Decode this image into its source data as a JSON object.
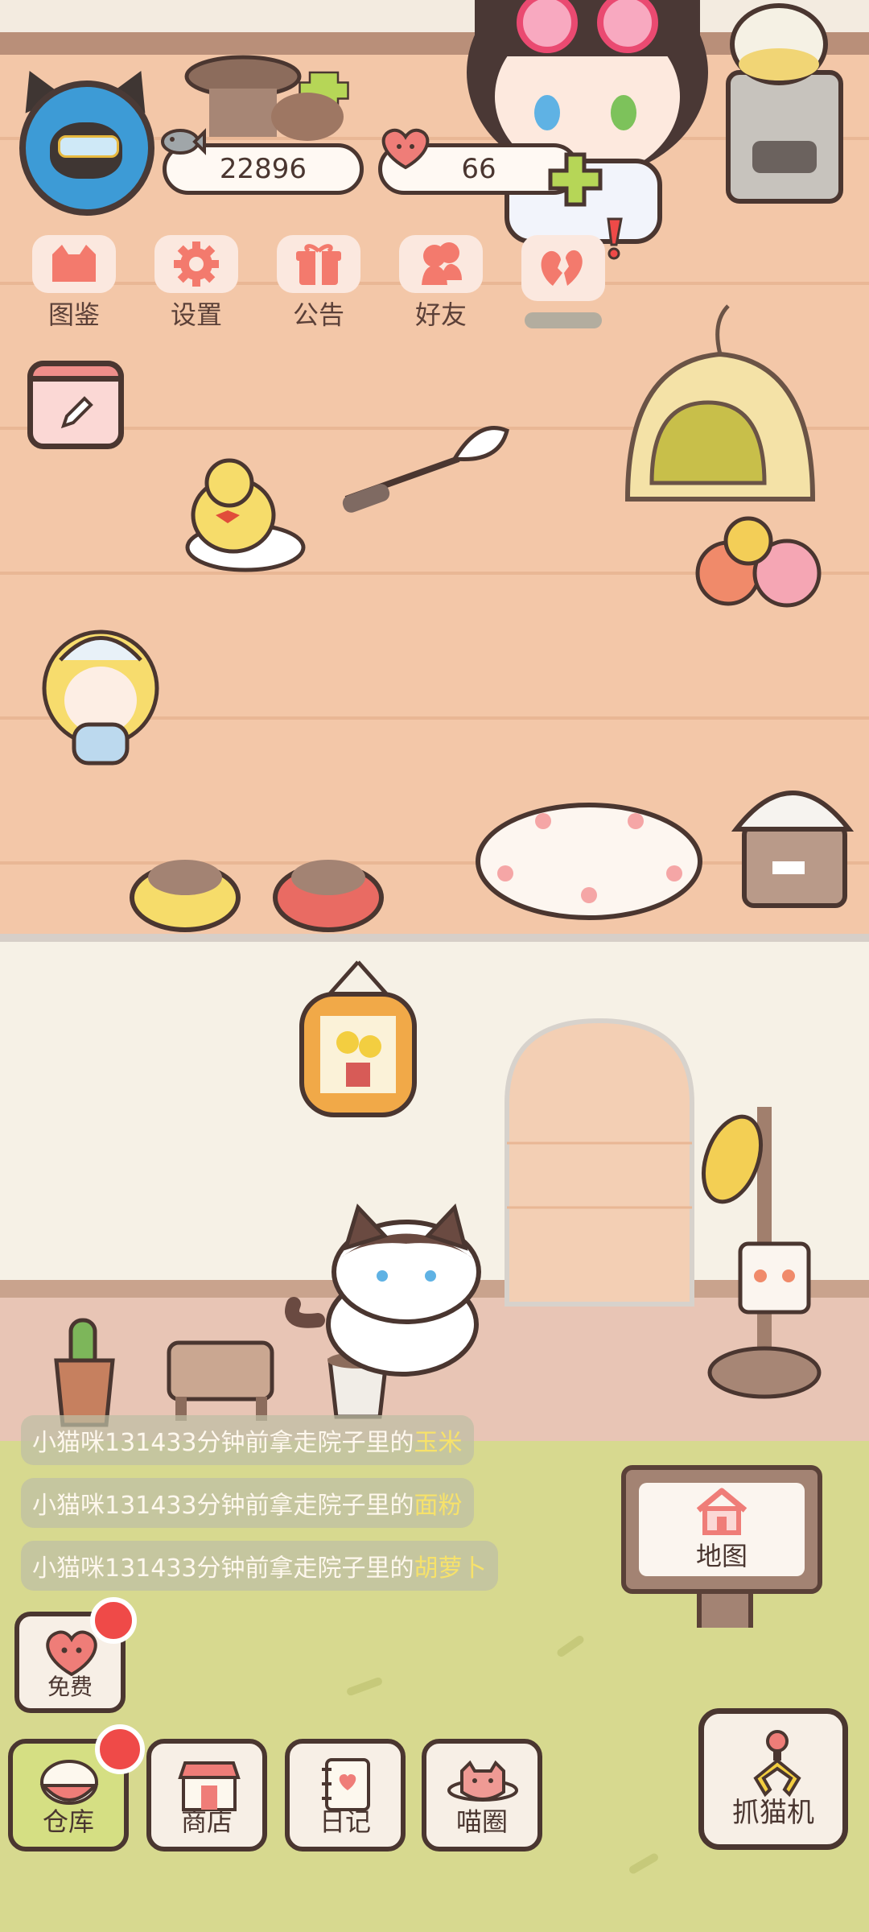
{
  "currency": {
    "fish": "22896",
    "hearts": "66"
  },
  "menu": [
    {
      "label": "图鉴",
      "icon": "cat-head-icon"
    },
    {
      "label": "设置",
      "icon": "gear-icon"
    },
    {
      "label": "公告",
      "icon": "gift-icon"
    },
    {
      "label": "好友",
      "icon": "friends-icon"
    },
    {
      "label": "",
      "icon": "broken-heart-icon"
    }
  ],
  "notifications": [
    {
      "prefix": "小猫咪131433分钟前拿走院子里的",
      "item": "玉米"
    },
    {
      "prefix": "小猫咪131433分钟前拿走院子里的",
      "item": "面粉"
    },
    {
      "prefix": "小猫咪131433分钟前拿走院子里的",
      "item": "胡萝卜"
    }
  ],
  "map_button": {
    "label": "地图",
    "icon": "house-icon"
  },
  "free_button": {
    "label": "免费",
    "icon": "heart-face-icon"
  },
  "bottom_nav": [
    {
      "label": "仓库",
      "icon": "rice-bowl-icon"
    },
    {
      "label": "商店",
      "icon": "shop-icon"
    },
    {
      "label": "日记",
      "icon": "diary-icon"
    },
    {
      "label": "喵圈",
      "icon": "cat-planet-icon"
    }
  ],
  "claw_machine": {
    "label": "抓猫机",
    "icon": "claw-icon"
  },
  "colors": {
    "floor": "#f3c7a8",
    "outline": "#4a3630",
    "accent_pink": "#ef8e8a",
    "badge_red": "#ef4a48",
    "lawn": "#d7d98f",
    "highlight_text": "#f7e26a"
  }
}
